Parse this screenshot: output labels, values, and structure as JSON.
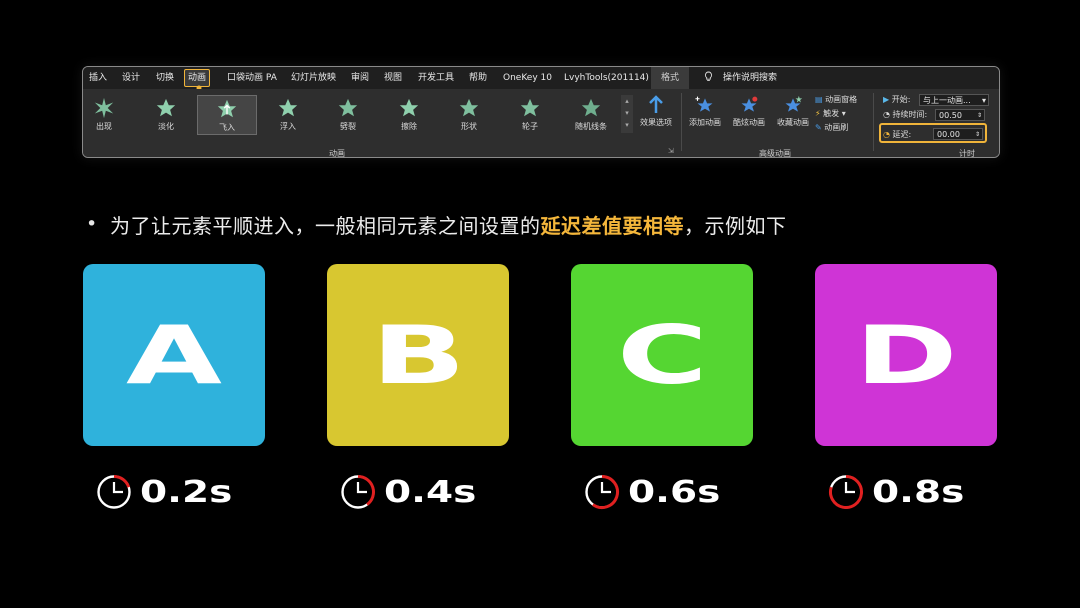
{
  "ribbon": {
    "tabs": [
      "插入",
      "设计",
      "切换",
      "动画",
      "口袋动画 PA",
      "幻灯片放映",
      "审阅",
      "视图",
      "开发工具",
      "帮助",
      "OneKey 10",
      "LvyhTools(201114)",
      "格式",
      "操作说明搜索"
    ],
    "animations": [
      "出现",
      "淡化",
      "飞入",
      "浮入",
      "劈裂",
      "擦除",
      "形状",
      "轮子",
      "随机线条"
    ],
    "effect_options": "效果选项",
    "group_animation": "动画",
    "advanced": {
      "add": "添加动画",
      "cool": "酷炫动画",
      "favorite": "收藏动画",
      "pane": "动画窗格",
      "trigger": "触发",
      "painter": "动画刷",
      "group_label": "高级动画"
    },
    "timing": {
      "start_label": "开始:",
      "start_value": "与上一动画...",
      "duration_label": "持续时间:",
      "duration_value": "00.50",
      "delay_label": "延迟:",
      "delay_value": "00.00",
      "group_label": "计时"
    }
  },
  "bullet": {
    "symbol": "•",
    "text_before": "为了让元素平顺进入，一般相同元素之间设置的",
    "highlight": "延迟差值要相等",
    "text_after": "，示例如下"
  },
  "cards": [
    {
      "letter": "A",
      "color": "#2fb2dc",
      "time": "0.2s",
      "fraction": 0.2
    },
    {
      "letter": "B",
      "color": "#d8c730",
      "time": "0.4s",
      "fraction": 0.4
    },
    {
      "letter": "C",
      "color": "#55d632",
      "time": "0.6s",
      "fraction": 0.6
    },
    {
      "letter": "D",
      "color": "#cf34d6",
      "time": "0.8s",
      "fraction": 0.8
    }
  ],
  "colors": {
    "highlight": "#f5b73b",
    "timer_red": "#e02020"
  }
}
